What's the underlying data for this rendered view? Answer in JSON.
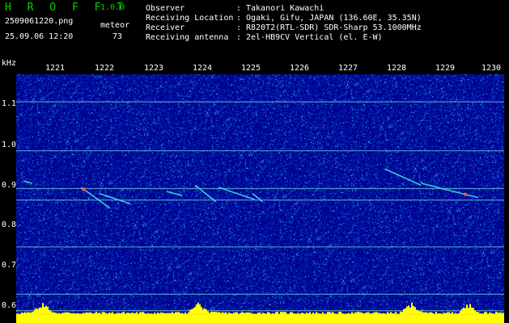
{
  "header": {
    "app_name": "H R O F F T",
    "version": "1.0.0",
    "filename": "2509061220.png",
    "datetime": "25.09.06 12:20",
    "meteor_label": "meteor",
    "meteor_count": "73"
  },
  "station_info": [
    {
      "key": "Observer",
      "colon": ":",
      "value": "Takanori Kawachi"
    },
    {
      "key": "Receiving Location",
      "colon": ":",
      "value": "Ogaki, Gifu, JAPAN (136.60E, 35.35N)"
    },
    {
      "key": "Receiver",
      "colon": ":",
      "value": "R820T2(RTL-SDR) SDR-Sharp 53.1000MHz"
    },
    {
      "key": "Receiving antenna",
      "colon": ":",
      "value": "2el-HB9CV Vertical (el. E-W)"
    }
  ],
  "axis": {
    "y_unit": "kHz",
    "y_ticks": [
      "1.1",
      "1.0",
      "0.9",
      "0.8",
      "0.7",
      "0.6"
    ],
    "y_values": [
      1.1,
      1.0,
      0.9,
      0.8,
      0.7,
      0.6
    ],
    "y_range": [
      0.585,
      1.19
    ],
    "x_ticks": [
      "1221",
      "1222",
      "1223",
      "1224",
      "1225",
      "1226",
      "1227",
      "1228",
      "1229",
      "1230"
    ],
    "x_values": [
      1221,
      1222,
      1223,
      1224,
      1225,
      1226,
      1227,
      1228,
      1229,
      1230
    ],
    "x_range": [
      1220.7,
      1230.1
    ]
  },
  "colors": {
    "background": "#000000",
    "noise_base": "#00008c",
    "logo": "#00d400",
    "text": "#ffffff",
    "carrier_line": "#5fb8d0",
    "echo": "#40e0e0",
    "echo_hot": "#ff6040",
    "signal_bar": "#ffff00",
    "signal_bar_top": "#ffe800"
  },
  "carriers_khz": [
    1.123,
    1.004,
    0.912,
    0.884,
    0.77,
    0.655,
    0.615,
    0.595
  ],
  "meteor_echoes": [
    {
      "t": [
        1221.95,
        1222.5
      ],
      "f": [
        0.915,
        0.865
      ],
      "hot_at": 1222.0
    },
    {
      "t": [
        1222.3,
        1222.9
      ],
      "f": [
        0.9,
        0.875
      ]
    },
    {
      "t": [
        1223.6,
        1223.9
      ],
      "f": [
        0.905,
        0.895
      ]
    },
    {
      "t": [
        1224.15,
        1224.55
      ],
      "f": [
        0.92,
        0.88
      ]
    },
    {
      "t": [
        1224.6,
        1225.3
      ],
      "f": [
        0.915,
        0.885
      ]
    },
    {
      "t": [
        1225.25,
        1225.45
      ],
      "f": [
        0.9,
        0.88
      ]
    },
    {
      "t": [
        1227.8,
        1228.5
      ],
      "f": [
        0.96,
        0.92
      ]
    },
    {
      "t": [
        1228.5,
        1229.6
      ],
      "f": [
        0.925,
        0.89
      ],
      "hot_at": 1229.35
    },
    {
      "t": [
        1220.85,
        1221.0
      ],
      "f": [
        0.93,
        0.925
      ]
    }
  ],
  "signal_peaks": [
    1221.2,
    1224.2,
    1228.3,
    1229.4
  ]
}
